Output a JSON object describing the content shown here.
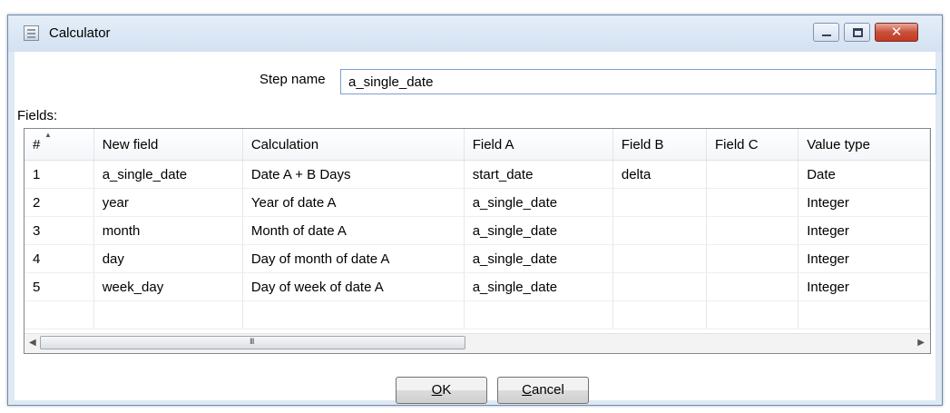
{
  "window": {
    "title": "Calculator",
    "close_symbol": "✕"
  },
  "step": {
    "label": "Step name",
    "value": "a_single_date"
  },
  "fields_label": "Fields:",
  "table": {
    "columns": [
      "#",
      "New field",
      "Calculation",
      "Field A",
      "Field B",
      "Field C",
      "Value type"
    ],
    "rows": [
      [
        "1",
        "a_single_date",
        "Date A + B Days",
        "start_date",
        "delta",
        "",
        "Date"
      ],
      [
        "2",
        "year",
        "Year of date A",
        "a_single_date",
        "",
        "",
        "Integer"
      ],
      [
        "3",
        "month",
        "Month of date A",
        "a_single_date",
        "",
        "",
        "Integer"
      ],
      [
        "4",
        "day",
        "Day of month of date A",
        "a_single_date",
        "",
        "",
        "Integer"
      ],
      [
        "5",
        "week_day",
        "Day of week of date A",
        "a_single_date",
        "",
        "",
        "Integer"
      ]
    ],
    "sort_indicator": "▲"
  },
  "scrollbar": {
    "left_arrow": "◀",
    "right_arrow": "▶",
    "grip": "III"
  },
  "buttons": {
    "ok_mnemonic": "O",
    "ok_rest": "K",
    "cancel_mnemonic": "C",
    "cancel_rest": "ancel"
  }
}
